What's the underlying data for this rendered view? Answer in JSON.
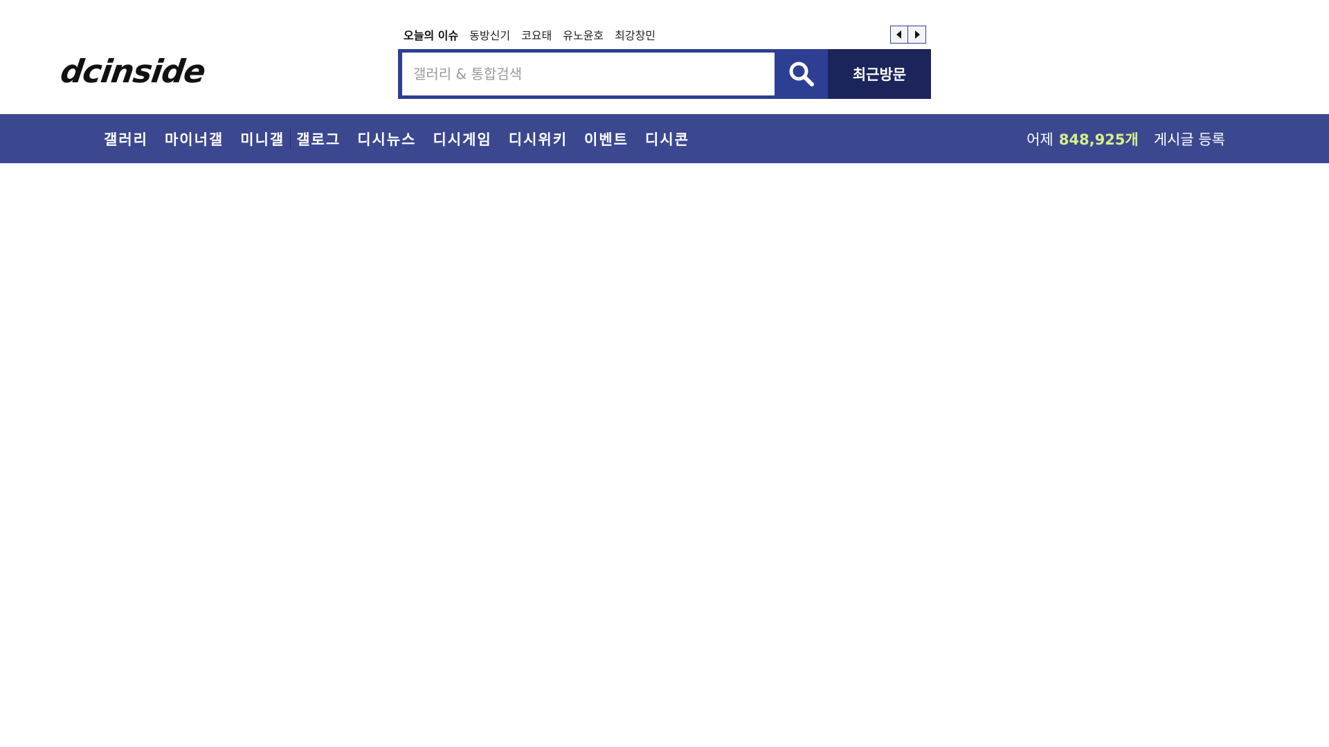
{
  "header": {
    "logo": "dcinside",
    "issues": {
      "title": "오늘의 이슈",
      "items": [
        "동방신기",
        "코요태",
        "유노윤호",
        "최강창민"
      ]
    },
    "search": {
      "placeholder": "갤러리 & 통합검색",
      "recent_label": "최근방문"
    }
  },
  "nav": {
    "items": [
      "갤러리",
      "마이너갤",
      "미니갤",
      "갤로그",
      "디시뉴스",
      "디시게임",
      "디시위키",
      "이벤트",
      "디시콘"
    ],
    "yesterday_label": "어제",
    "post_count": "848,925개",
    "register_label": "게시글 등록"
  },
  "colors": {
    "brand_blue": "#3b4890",
    "search_border": "#2c3f93",
    "recent_button": "#1b255c",
    "count_highlight": "#d6f08a"
  },
  "icons": {
    "search": "search-icon",
    "prev": "caret-left-icon",
    "next": "caret-right-icon"
  }
}
